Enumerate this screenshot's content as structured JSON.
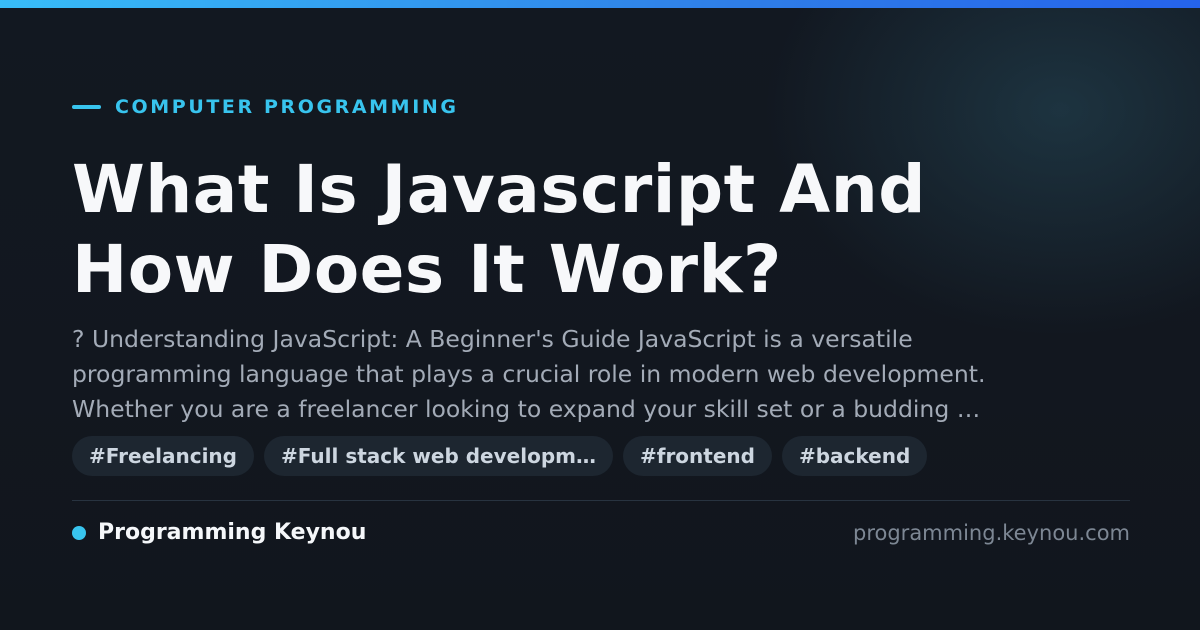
{
  "header": {
    "category": "COMPUTER PROGRAMMING"
  },
  "article": {
    "title_lines": [
      "What Is Javascript And",
      "How Does It Work?"
    ],
    "description_lines": [
      "? Understanding JavaScript: A Beginner's Guide JavaScript is a versatile",
      "programming language that plays a crucial role in modern web development.",
      "Whether you are a freelancer looking to expand your skill set or a budding …"
    ],
    "tags": [
      "#Freelancing",
      "#Full stack web developm…",
      "#frontend",
      "#backend"
    ]
  },
  "footer": {
    "site_name": "Programming Keynou",
    "domain": "programming.keynou.com"
  },
  "colors": {
    "accent": "#38c4ee",
    "background": "#12171f",
    "tag_background": "#1d2630"
  },
  "icons": {
    "eyebrow": "accent-line-icon",
    "brand": "dot-icon"
  }
}
